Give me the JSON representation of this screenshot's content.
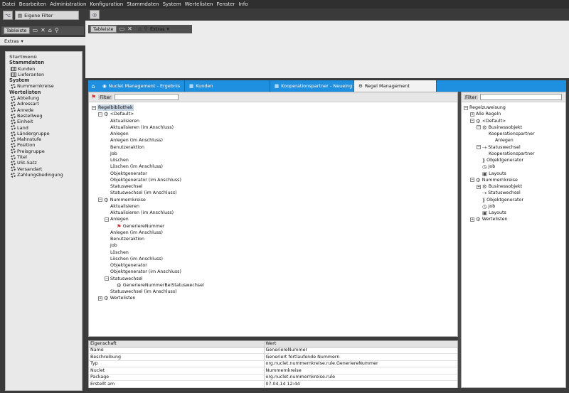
{
  "menubar": [
    "Datei",
    "Bearbeiten",
    "Administration",
    "Konfiguration",
    "Stammdaten",
    "System",
    "Wertelisten",
    "Fenster",
    "Info"
  ],
  "left": {
    "filter_tab": "Eigene Filter",
    "tableiste": "Tableiste",
    "extras": "Extras",
    "startmenu": {
      "title": "Startmenü",
      "stammdaten_head": "Stammdaten",
      "stammdaten": [
        "Kunden",
        "Lieferanten"
      ],
      "system_head": "System",
      "system": [
        "Nummernkreise"
      ],
      "wertelisten_head": "Wertelisten",
      "wertelisten": [
        "Abteilung",
        "Adressart",
        "Anrede",
        "Bestellweg",
        "Einheit",
        "Land",
        "Ländergruppe",
        "Mahnstufe",
        "Position",
        "Preisgruppe",
        "Titel",
        "USt-Satz",
        "Versandart",
        "Zahlungsbedingung"
      ]
    }
  },
  "top": {
    "tableiste": "Tableiste",
    "extras": "Extras"
  },
  "tabs": [
    "Nuclet Management - Ergebnis",
    "Kunden",
    "Kooperationspartner - Neueing:",
    "Regel Management"
  ],
  "main": {
    "filter_label": "Filter",
    "tree": [
      {
        "label": "Regelbibliothek",
        "level": 0,
        "exp": "-",
        "sel": true
      },
      {
        "label": "<Default>",
        "level": 1,
        "exp": "-",
        "icon": "gear"
      },
      {
        "label": "Aktualisieren",
        "level": 2
      },
      {
        "label": "Aktualisieren (im Anschluss)",
        "level": 2
      },
      {
        "label": "Anlegen",
        "level": 2
      },
      {
        "label": "Anlegen (im Anschluss)",
        "level": 2
      },
      {
        "label": "Benutzeraktion",
        "level": 2
      },
      {
        "label": "Job",
        "level": 2
      },
      {
        "label": "Löschen",
        "level": 2
      },
      {
        "label": "Löschen (im Anschluss)",
        "level": 2
      },
      {
        "label": "Objektgenerator",
        "level": 2
      },
      {
        "label": "Objektgenerator (im Anschluss)",
        "level": 2
      },
      {
        "label": "Statuswechsel",
        "level": 2
      },
      {
        "label": "Statuswechsel (im Anschluss)",
        "level": 2
      },
      {
        "label": "Nummernkreise",
        "level": 1,
        "exp": "-",
        "icon": "gear"
      },
      {
        "label": "Aktualisieren",
        "level": 2
      },
      {
        "label": "Aktualisieren (im Anschluss)",
        "level": 2
      },
      {
        "label": "Anlegen",
        "level": 2,
        "exp": "-"
      },
      {
        "label": "GeneriereNummer",
        "level": 3,
        "icon": "rule"
      },
      {
        "label": "Anlegen (im Anschluss)",
        "level": 2
      },
      {
        "label": "Benutzeraktion",
        "level": 2
      },
      {
        "label": "Job",
        "level": 2
      },
      {
        "label": "Löschen",
        "level": 2
      },
      {
        "label": "Löschen (im Anschluss)",
        "level": 2
      },
      {
        "label": "Objektgenerator",
        "level": 2
      },
      {
        "label": "Objektgenerator (im Anschluss)",
        "level": 2
      },
      {
        "label": "Statuswechsel",
        "level": 2,
        "exp": "-"
      },
      {
        "label": "GeneriereNummerBeiStatuswechsel",
        "level": 3,
        "icon": "gear"
      },
      {
        "label": "Statuswechsel (im Anschluss)",
        "level": 2
      },
      {
        "label": "Wertelisten",
        "level": 1,
        "exp": "+",
        "icon": "gear"
      }
    ]
  },
  "right": {
    "filter_label": "Filter",
    "tree": [
      {
        "label": "Regelzuweisung",
        "level": 0,
        "exp": "-"
      },
      {
        "label": "Alle Regeln",
        "level": 1,
        "exp": "+"
      },
      {
        "label": "<Default>",
        "level": 1,
        "exp": "-",
        "icon": "gear"
      },
      {
        "label": "Businessobjekt",
        "level": 2,
        "exp": "-",
        "icon": "gear"
      },
      {
        "label": "Kooperationspartner",
        "level": 3
      },
      {
        "label": "Anlegen",
        "level": 4
      },
      {
        "label": "Statuswechsel",
        "level": 2,
        "exp": "-",
        "icon": "arrow"
      },
      {
        "label": "Kooperationspartner",
        "level": 3
      },
      {
        "label": "Objektgenerator",
        "level": 2,
        "icon": "gen"
      },
      {
        "label": "Job",
        "level": 2,
        "icon": "clock"
      },
      {
        "label": "Layouts",
        "level": 2,
        "icon": "layout"
      },
      {
        "label": "Nummernkreise",
        "level": 1,
        "exp": "-",
        "icon": "gear"
      },
      {
        "label": "Businessobjekt",
        "level": 2,
        "exp": "+",
        "icon": "gear"
      },
      {
        "label": "Statuswechsel",
        "level": 2,
        "icon": "arrow"
      },
      {
        "label": "Objektgenerator",
        "level": 2,
        "icon": "gen"
      },
      {
        "label": "Job",
        "level": 2,
        "icon": "clock"
      },
      {
        "label": "Layouts",
        "level": 2,
        "icon": "layout"
      },
      {
        "label": "Wertelisten",
        "level": 1,
        "exp": "+",
        "icon": "gear"
      }
    ]
  },
  "props": {
    "headers": [
      "Eigenschaft",
      "Wert"
    ],
    "rows": [
      [
        "Name",
        "GeneriereNummer"
      ],
      [
        "Beschreibung",
        "Generiert fortlaufende Nummern"
      ],
      [
        "Typ",
        "org.nuclet.nummernkreise.rule.GeneriereNummer"
      ],
      [
        "Nuclet",
        "Nummernkreise"
      ],
      [
        "Package",
        "org.nuclet.nummernkreise.rule"
      ],
      [
        "Erstellt am",
        "07.04.14 12:44"
      ]
    ]
  },
  "colors": {
    "accent": "#1f8fe0",
    "dark": "#3a3a3a"
  }
}
